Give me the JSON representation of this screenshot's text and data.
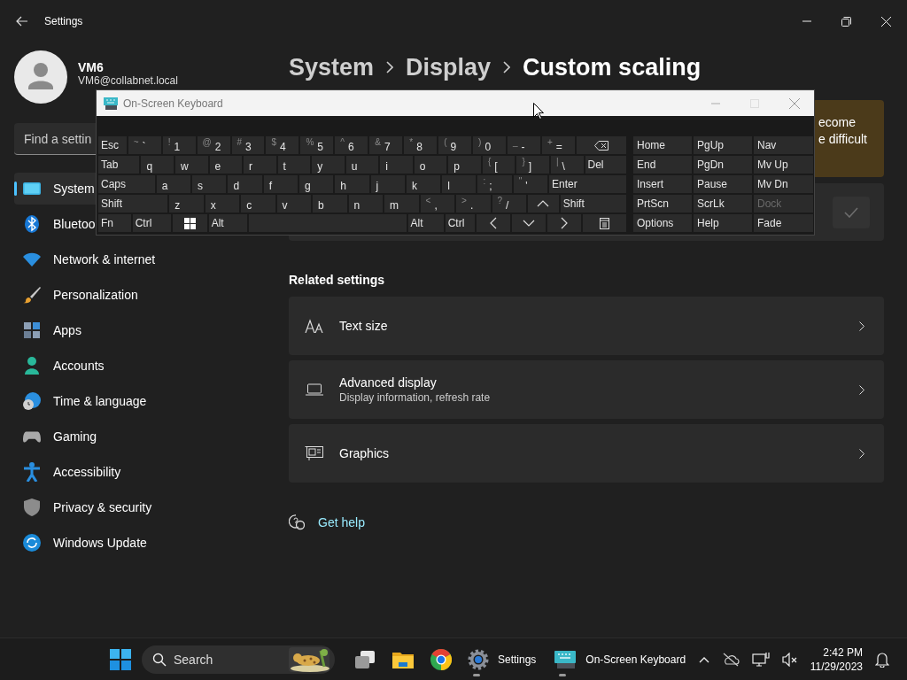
{
  "window": {
    "title": "Settings"
  },
  "account": {
    "name": "VM6",
    "email": "VM6@collabnet.local"
  },
  "search": {
    "placeholder": "Find a settin"
  },
  "nav": [
    {
      "label": "System",
      "selected": true
    },
    {
      "label": "Bluetoo",
      "selected": false
    },
    {
      "label": "Network & internet",
      "selected": false
    },
    {
      "label": "Personalization",
      "selected": false
    },
    {
      "label": "Apps",
      "selected": false
    },
    {
      "label": "Accounts",
      "selected": false
    },
    {
      "label": "Time & language",
      "selected": false
    },
    {
      "label": "Gaming",
      "selected": false
    },
    {
      "label": "Accessibility",
      "selected": false
    },
    {
      "label": "Privacy & security",
      "selected": false
    },
    {
      "label": "Windows Update",
      "selected": false
    }
  ],
  "breadcrumb": [
    "System",
    "Display",
    "Custom scaling"
  ],
  "warning": {
    "lines": [
      "ecome",
      "e difficult"
    ]
  },
  "apply_button": {
    "disabled": true
  },
  "related_settings": {
    "heading": "Related settings",
    "items": [
      {
        "title": "Text size"
      },
      {
        "title": "Advanced display",
        "subtitle": "Display information, refresh rate"
      },
      {
        "title": "Graphics"
      }
    ]
  },
  "help_link": "Get help",
  "osk": {
    "title": "On-Screen Keyboard",
    "rows": [
      {
        "keys": [
          {
            "kind": "mod",
            "label": "Esc"
          },
          {
            "kind": "char",
            "shift": "~",
            "label": "`"
          },
          {
            "kind": "char",
            "shift": "!",
            "label": "1"
          },
          {
            "kind": "char",
            "shift": "@",
            "label": "2"
          },
          {
            "kind": "char",
            "shift": "#",
            "label": "3"
          },
          {
            "kind": "char",
            "shift": "$",
            "label": "4"
          },
          {
            "kind": "char",
            "shift": "%",
            "label": "5"
          },
          {
            "kind": "char",
            "shift": "^",
            "label": "6"
          },
          {
            "kind": "char",
            "shift": "&",
            "label": "7"
          },
          {
            "kind": "char",
            "shift": "*",
            "label": "8"
          },
          {
            "kind": "char",
            "shift": "(",
            "label": "9"
          },
          {
            "kind": "char",
            "shift": ")",
            "label": "0"
          },
          {
            "kind": "char",
            "shift": "_",
            "label": "-"
          },
          {
            "kind": "char",
            "shift": "+",
            "label": "="
          },
          {
            "kind": "backspace"
          }
        ]
      },
      {
        "keys": [
          {
            "kind": "mod",
            "label": "Tab"
          },
          {
            "kind": "char",
            "label": "q"
          },
          {
            "kind": "char",
            "label": "w"
          },
          {
            "kind": "char",
            "label": "e"
          },
          {
            "kind": "char",
            "label": "r"
          },
          {
            "kind": "char",
            "label": "t"
          },
          {
            "kind": "char",
            "label": "y"
          },
          {
            "kind": "char",
            "label": "u"
          },
          {
            "kind": "char",
            "label": "i"
          },
          {
            "kind": "char",
            "label": "o"
          },
          {
            "kind": "char",
            "label": "p"
          },
          {
            "kind": "char",
            "shift": "{",
            "label": "["
          },
          {
            "kind": "char",
            "shift": "}",
            "label": "]"
          },
          {
            "kind": "char",
            "shift": "|",
            "label": "\\"
          },
          {
            "kind": "mod",
            "label": "Del"
          }
        ]
      },
      {
        "keys": [
          {
            "kind": "mod",
            "label": "Caps"
          },
          {
            "kind": "char",
            "label": "a"
          },
          {
            "kind": "char",
            "label": "s"
          },
          {
            "kind": "char",
            "label": "d"
          },
          {
            "kind": "char",
            "label": "f"
          },
          {
            "kind": "char",
            "label": "g"
          },
          {
            "kind": "char",
            "label": "h"
          },
          {
            "kind": "char",
            "label": "j"
          },
          {
            "kind": "char",
            "label": "k"
          },
          {
            "kind": "char",
            "label": "l"
          },
          {
            "kind": "char",
            "shift": ":",
            "label": ";"
          },
          {
            "kind": "char",
            "shift": "\"",
            "label": "'"
          },
          {
            "kind": "mod",
            "label": "Enter"
          }
        ]
      },
      {
        "keys": [
          {
            "kind": "mod",
            "label": "Shift"
          },
          {
            "kind": "char",
            "label": "z"
          },
          {
            "kind": "char",
            "label": "x"
          },
          {
            "kind": "char",
            "label": "c"
          },
          {
            "kind": "char",
            "label": "v"
          },
          {
            "kind": "char",
            "label": "b"
          },
          {
            "kind": "char",
            "label": "n"
          },
          {
            "kind": "char",
            "label": "m"
          },
          {
            "kind": "char",
            "shift": "<",
            "label": ","
          },
          {
            "kind": "char",
            "shift": ">",
            "label": "."
          },
          {
            "kind": "char",
            "shift": "?",
            "label": "/"
          },
          {
            "kind": "up"
          },
          {
            "kind": "mod",
            "label": "Shift"
          }
        ]
      },
      {
        "keys": [
          {
            "kind": "mod",
            "label": "Fn"
          },
          {
            "kind": "mod",
            "label": "Ctrl"
          },
          {
            "kind": "win"
          },
          {
            "kind": "mod",
            "label": "Alt"
          },
          {
            "kind": "space"
          },
          {
            "kind": "mod",
            "label": "Alt"
          },
          {
            "kind": "mod",
            "label": "Ctrl"
          },
          {
            "kind": "left"
          },
          {
            "kind": "down"
          },
          {
            "kind": "right"
          },
          {
            "kind": "menu"
          }
        ]
      }
    ],
    "nav_keys": [
      {
        "label": "Home",
        "disabled": false
      },
      {
        "label": "PgUp",
        "disabled": false
      },
      {
        "label": "Nav",
        "disabled": false
      },
      {
        "label": "End",
        "disabled": false
      },
      {
        "label": "PgDn",
        "disabled": false
      },
      {
        "label": "Mv Up",
        "disabled": false
      },
      {
        "label": "Insert",
        "disabled": false
      },
      {
        "label": "Pause",
        "disabled": false
      },
      {
        "label": "Mv Dn",
        "disabled": false
      },
      {
        "label": "PrtScn",
        "disabled": false
      },
      {
        "label": "ScrLk",
        "disabled": false
      },
      {
        "label": "Dock",
        "disabled": true
      },
      {
        "label": "Options",
        "disabled": false
      },
      {
        "label": "Help",
        "disabled": false
      },
      {
        "label": "Fade",
        "disabled": false
      }
    ]
  },
  "taskbar": {
    "search": {
      "placeholder": "Search"
    },
    "apps": [
      {
        "kind": "taskview",
        "running": false
      },
      {
        "kind": "explorer",
        "running": false
      },
      {
        "kind": "chrome",
        "running": false
      },
      {
        "kind": "settings",
        "label": "Settings",
        "running": true
      },
      {
        "kind": "osk",
        "label": "On-Screen Keyboard",
        "running": true
      }
    ],
    "time": "2:42 PM",
    "date": "11/29/2023"
  }
}
